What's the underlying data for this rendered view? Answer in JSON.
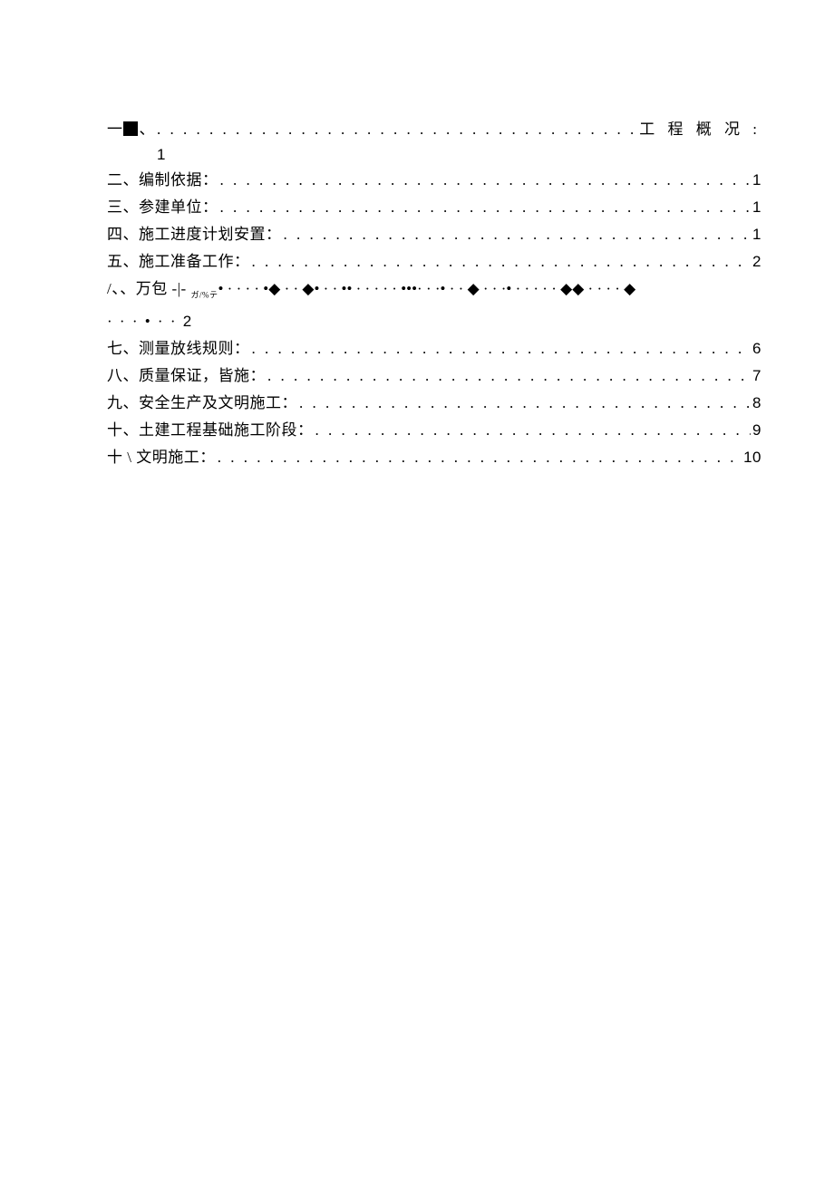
{
  "toc": {
    "entry1": {
      "prefix": "一",
      "sep": "、",
      "suffix": "工 程 概 况 :",
      "page": "1"
    },
    "entry2": {
      "label": "二、编制依据：",
      "page": "1"
    },
    "entry3": {
      "label": "三、参建单位：",
      "page": "1"
    },
    "entry4": {
      "label": "四、施工进度计划安置：",
      "page": "1"
    },
    "entry5": {
      "label": "五、施工准备工作：",
      "page": "2"
    },
    "entry6": {
      "line1": "/、、万包 -|- ",
      "garble_sub": "ガ/%テ",
      "dots": "• · · ·   · •◆ · ·   ◆• · · •• · · ·   · · •••· · ·• ·   · ◆ · · ·• · · · ·  · ◆◆ · · ·  · ◆",
      "line2_dots": "·  ·  · •  ·  ·",
      "page": "2"
    },
    "entry7": {
      "label": "七、测量放线规则：",
      "page": "6"
    },
    "entry8": {
      "label": "八、质量保证，皆施：",
      "page": "7"
    },
    "entry9": {
      "label": "九、安全生产及文明施工：",
      "page": "8"
    },
    "entry10": {
      "label": "十、土建工程基础施工阶段：",
      "page": "9"
    },
    "entry11": {
      "label": "十 \\ 文明施工：",
      "page": "10"
    }
  }
}
